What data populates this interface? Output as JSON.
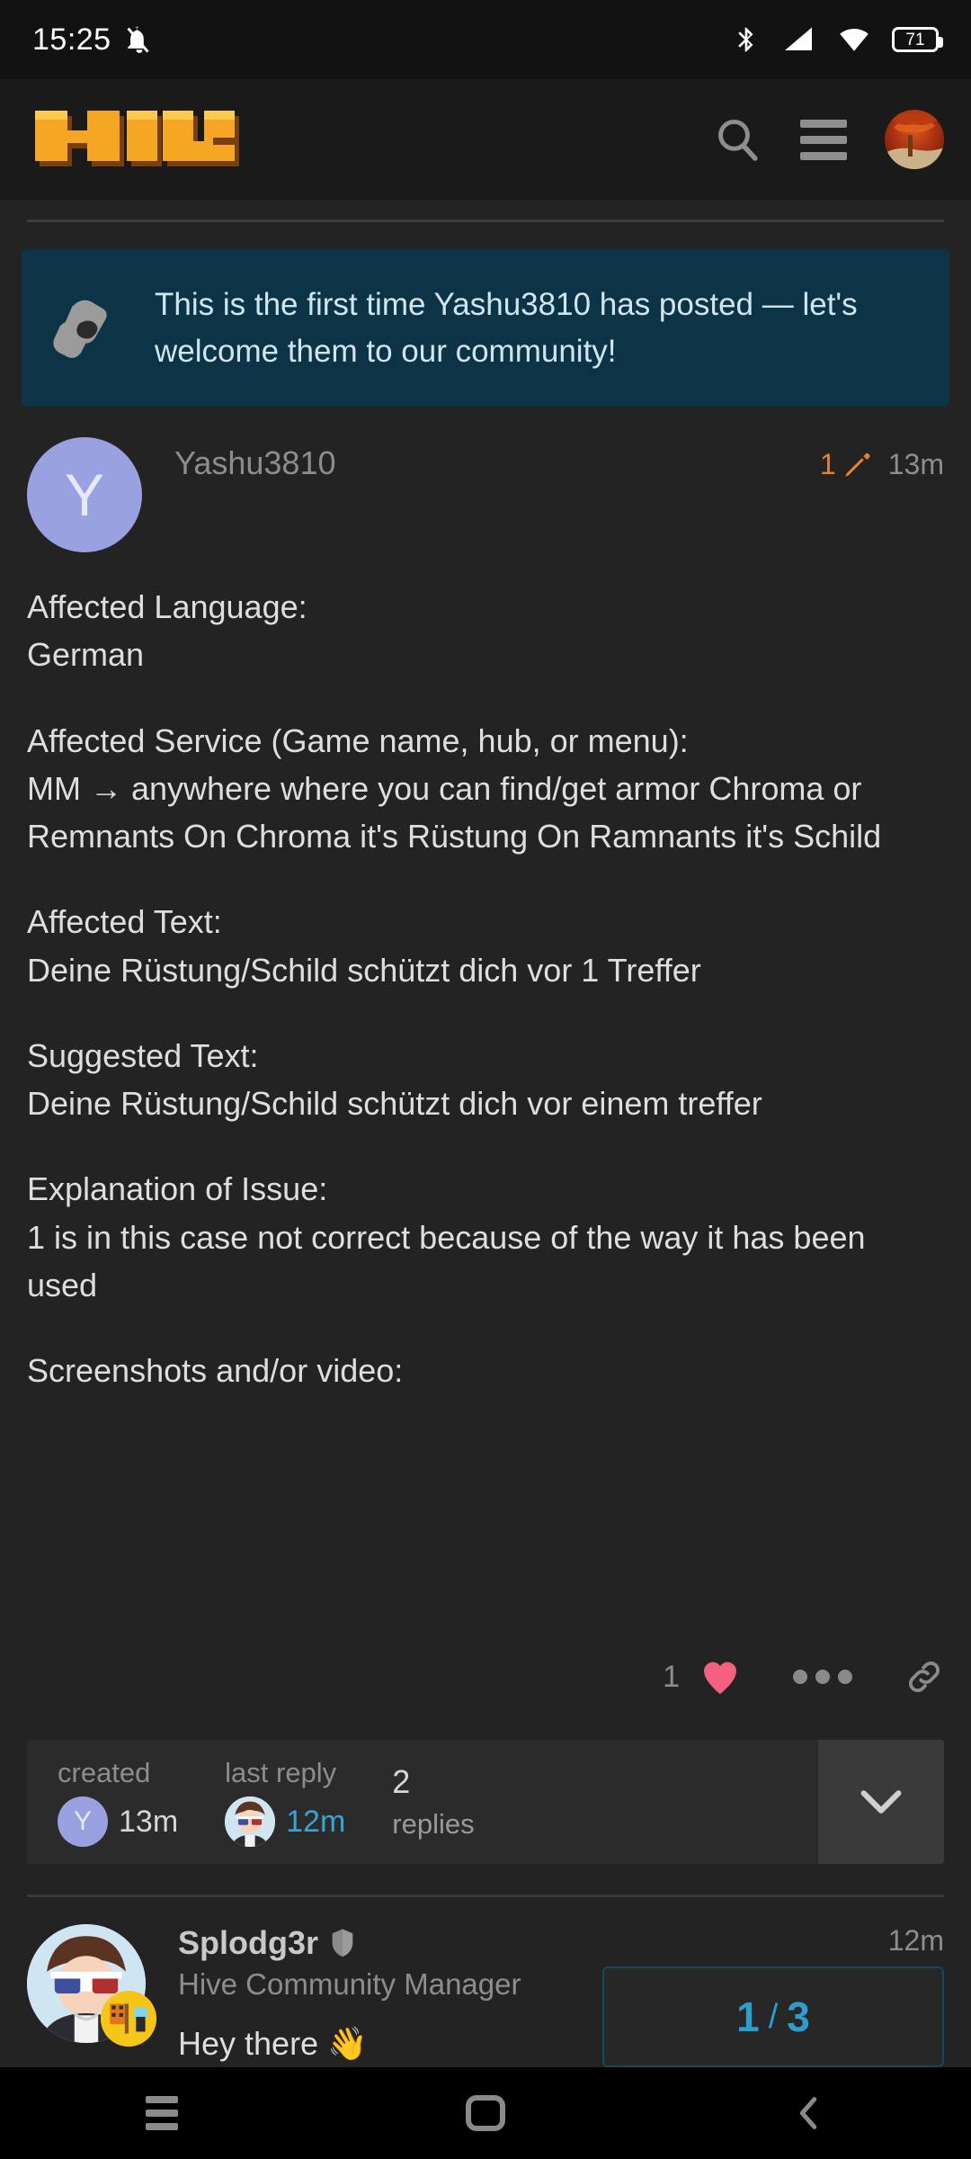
{
  "status_bar": {
    "time": "15:25",
    "icons": [
      "notifications-silenced-icon",
      "bluetooth-icon",
      "cellular-signal-icon",
      "wifi-icon"
    ],
    "battery_percent": "71"
  },
  "app_bar": {
    "logo_text": "HIVE",
    "search_icon": "search-icon",
    "menu_icon": "hamburger-menu-icon",
    "avatar": "user-avatar-autumn-forest"
  },
  "banner": {
    "icon": "waving-hands-icon",
    "text": "This is the first time Yashu3810 has posted — let's welcome them to our community!"
  },
  "post": {
    "avatar_letter": "Y",
    "username": "Yashu3810",
    "edit_count": "1",
    "edit_icon": "pencil-edit-icon",
    "timestamp": "13m",
    "body": [
      [
        "Affected Language:",
        "German"
      ],
      [
        "Affected Service (Game name, hub, or menu):",
        "MM → anywhere where you can find/get armor Chroma or Remnants On Chroma it's Rüstung On Ramnants it's Schild"
      ],
      [
        "Affected Text:",
        "Deine Rüstung/Schild schützt dich vor 1 Treffer"
      ],
      [
        "Suggested Text:",
        "Deine Rüstung/Schild schützt dich vor einem treffer"
      ],
      [
        "Explanation of Issue:",
        "1 is in this case not correct because of the way it has been used"
      ],
      [
        "Screenshots and/or video:"
      ]
    ],
    "actions": {
      "like_count": "1",
      "heart_icon": "heart-like-icon",
      "more_icon": "more-options-icon",
      "link_icon": "share-link-icon"
    }
  },
  "summary": {
    "created_label": "created",
    "created_avatar_letter": "Y",
    "created_time": "13m",
    "last_reply_label": "last reply",
    "last_reply_avatar": "splodg3r-avatar",
    "last_reply_time": "12m",
    "replies_count": "2",
    "replies_word": "replies",
    "expand_icon": "chevron-down-icon"
  },
  "reply": {
    "avatar": "splodg3r-avatar",
    "badge": "minecraft-flag-badge",
    "username": "Splodg3r",
    "shield_icon": "moderator-shield-icon",
    "user_title": "Hive Community Manager",
    "timestamp": "12m",
    "body": "Hey there 👋"
  },
  "progress": {
    "current": "1",
    "separator": "/",
    "total": "3"
  },
  "nav_bar": {
    "recents_icon": "recents-icon",
    "home_icon": "home-icon",
    "back_icon": "back-chevron-icon"
  }
}
